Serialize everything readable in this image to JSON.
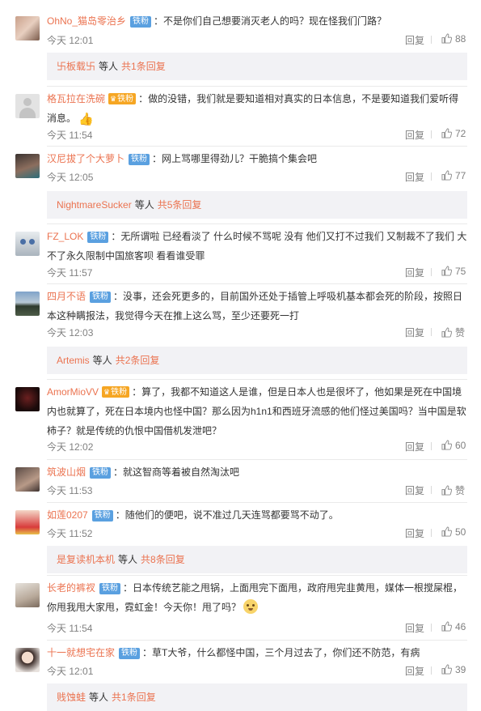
{
  "comments": [
    {
      "name": "OhNo_猫岛零治乡",
      "badge": "铁粉",
      "text": "：不是你们自己想要消灭老人的吗？现在怪我们门路？",
      "time": "今天 12:01",
      "reply": "回复",
      "likes": "88"
    },
    {
      "name": "格瓦拉在洗碗",
      "badge": "铁粉",
      "text": "：做的没错，我们就是要知道相对真实的日本信息，不是要知道我们爱听得消息。",
      "time": "今天 11:54",
      "reply": "回复",
      "likes": "72"
    },
    {
      "name": "汉尼拔了个大萝卜",
      "badge": "铁粉",
      "text": "：网上骂哪里得劲儿？干脆搞个集会吧",
      "time": "今天 12:05",
      "reply": "回复",
      "likes": "77"
    },
    {
      "name": "FZ_LOK",
      "badge": "铁粉",
      "text": "：无所谓啦 已经看淡了 什么时候不骂呢 没有 他们又打不过我们 又制裁不了我们 大不了永久限制中国旅客呗 看看谁受罪",
      "time": "今天 11:57",
      "reply": "回复",
      "likes": "75"
    },
    {
      "name": "四月不语",
      "badge": "铁粉",
      "text": "：没事，还会死更多的，目前国外还处于插管上呼吸机基本都会死的阶段，按照日本这种瞒报法，我觉得今天在推上这么骂，至少还要死一打",
      "time": "今天 12:03",
      "reply": "回复",
      "likes": "赞"
    },
    {
      "name": "AmorMioVV",
      "badge": "铁粉",
      "text": "：算了，我都不知道这人是谁，但是日本人也是很坏了，他如果是死在中国境内也就算了，死在日本境内也怪中国？那么因为h1n1和西班牙流感的他们怪过美国吗？当中国是软柿子？就是传统的仇恨中国借机发泄吧？",
      "time": "今天 12:02",
      "reply": "回复",
      "likes": "60"
    },
    {
      "name": "筑波山烟",
      "badge": "铁粉",
      "text": "：就这智商等着被自然淘汰吧",
      "time": "今天 11:53",
      "reply": "回复",
      "likes": "赞"
    },
    {
      "name": "如莲0207",
      "badge": "铁粉",
      "text": "：随他们的便吧，说不准过几天连骂都要骂不动了。",
      "time": "今天 11:52",
      "reply": "回复",
      "likes": "50"
    },
    {
      "name": "长老的裤衩",
      "badge": "铁粉",
      "text": "：日本传统艺能之甩锅，上面甩完下面甩，政府甩完韭黄甩，媒体一根搅屎棍，你甩我甩大家甩，霓虹金！今天你！甩了吗？",
      "time": "今天 11:54",
      "reply": "回复",
      "likes": "46"
    },
    {
      "name": "十一就想宅在家",
      "badge": "铁粉",
      "text": "：草T大爷，什么都怪中国，三个月过去了，你们还不防范，有病",
      "time": "今天 12:01",
      "reply": "回复",
      "likes": "39"
    }
  ],
  "subreplies": [
    {
      "name": "卐板载卐",
      "etc": "等人",
      "total": "共1条回复"
    },
    {
      "name": "NightmareSucker",
      "etc": "等人",
      "total": "共5条回复"
    },
    {
      "name": "Artemis",
      "etc": "等人",
      "total": "共2条回复"
    },
    {
      "name": "是复读机本机",
      "etc": "等人",
      "total": "共8条回复"
    },
    {
      "name": "贱蚀蛙",
      "etc": "等人",
      "total": "共1条回复"
    }
  ],
  "colors": {
    "username": "#eb7350",
    "badge": "#5aa0e0",
    "meta": "#808080",
    "subbar": "#f2f2f5"
  }
}
